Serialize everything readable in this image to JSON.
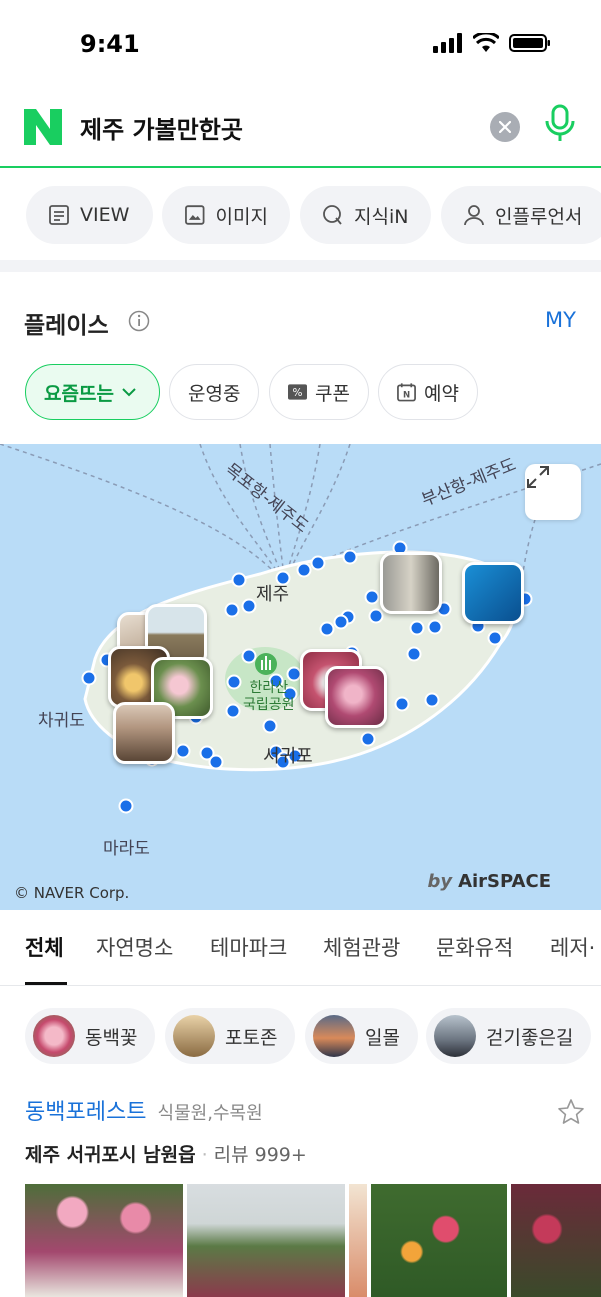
{
  "status": {
    "time": "9:41"
  },
  "search": {
    "query": "제주 가볼만한곳"
  },
  "tabs": [
    {
      "label": "VIEW",
      "icon": "doc-icon"
    },
    {
      "label": "이미지",
      "icon": "image-icon"
    },
    {
      "label": "지식iN",
      "icon": "q-icon"
    },
    {
      "label": "인플루언서",
      "icon": "person-icon"
    }
  ],
  "places": {
    "title": "플레이스",
    "my_label": "MY"
  },
  "filters": {
    "trending": "요즘뜨는",
    "open": "운영중",
    "coupon": "쿠폰",
    "reserve": "예약"
  },
  "map": {
    "labels": {
      "route1": "목포항-제주도",
      "route2": "부산항-제주도",
      "jeju": "제주",
      "hallasan": "한라산\n국립공원",
      "chagwido": "차귀도",
      "seogwipo": "서귀포",
      "marado": "마라도"
    },
    "copyright": "© NAVER Corp.",
    "brand_by": "by",
    "brand": "AirSPACE",
    "colors": {
      "sea": "#b9dcf7",
      "land": "#e8eee3",
      "pin": "#1a6fe8",
      "park": "#c7e6c6"
    }
  },
  "categories": [
    "전체",
    "자연명소",
    "테마파크",
    "체험관광",
    "문화유적",
    "레저·"
  ],
  "tags": [
    "동백꽃",
    "포토존",
    "일몰",
    "걷기좋은길"
  ],
  "result": {
    "name": "동백포레스트",
    "category": "식물원,수목원",
    "address": "제주 서귀포시 남원읍",
    "review": "리뷰 999+"
  },
  "colors": {
    "accent": "#19ce60",
    "link": "#1a72d9"
  }
}
